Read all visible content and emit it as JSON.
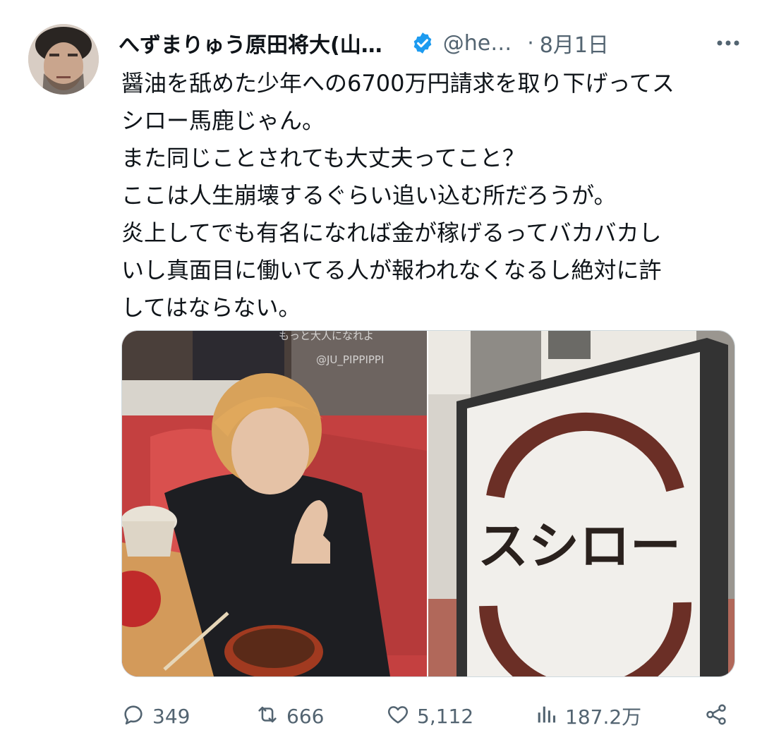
{
  "tweet": {
    "author_name": "へずまりゅう原田将大(山…",
    "handle": "@he…",
    "separator": "·",
    "date": "8月1日",
    "verified_color": "#1d9bf0",
    "text_lines": [
      "醤油を舐めた少年への6700万円請求を取り下げってス",
      "シロー馬鹿じゃん。",
      "また同じことされても大丈夫ってこと？",
      "ここは人生崩壊するぐらい追い込む所だろうが。",
      "炎上してでも有名になれば金が稼げるってバカバカし",
      "いし真面目に働いてる人が報われなくなるし絶対に許",
      "してはならない。"
    ],
    "media": {
      "left_image": {
        "overlay_caption": "もっと大人になれよ",
        "overlay_watermark": "@JU_PIPPIPPI"
      },
      "right_image": {
        "sign_text": "スシロー",
        "logo_color": "#6b2f26"
      }
    },
    "actions": {
      "replies": "349",
      "reposts": "666",
      "likes": "5,112",
      "views": "187.2万"
    },
    "icons": {
      "verified": "verified-badge-icon",
      "more": "more-options-icon",
      "reply": "reply-icon",
      "repost": "repost-icon",
      "like": "like-icon",
      "views": "views-icon",
      "share": "share-icon"
    }
  }
}
